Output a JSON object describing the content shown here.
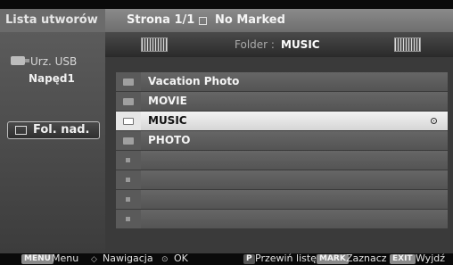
{
  "sidebar": {
    "title": "Lista utworów",
    "usb_label": "Urz. USB",
    "drive_label": "Napęd1",
    "parent_folder_label": "Fol. nad."
  },
  "header": {
    "page": "Strona 1/1",
    "marked": "No Marked"
  },
  "folder_bar": {
    "prefix": "Folder :",
    "name": "MUSIC"
  },
  "list": {
    "items": [
      {
        "label": "Vacation Photo",
        "type": "folder",
        "selected": false
      },
      {
        "label": "MOVIE",
        "type": "folder",
        "selected": false
      },
      {
        "label": "MUSIC",
        "type": "folder",
        "selected": true
      },
      {
        "label": "PHOTO",
        "type": "folder",
        "selected": false
      },
      {
        "label": "",
        "type": "empty",
        "selected": false
      },
      {
        "label": "",
        "type": "empty",
        "selected": false
      },
      {
        "label": "",
        "type": "empty",
        "selected": false
      },
      {
        "label": "",
        "type": "empty",
        "selected": false
      }
    ]
  },
  "bottom_bar": {
    "menu_key": "MENU",
    "menu_label": "Menu",
    "nav_icon": "navigation-arrows-icon",
    "nav_label": "Nawigacja",
    "ok_icon": "ok-icon",
    "ok_label": "OK",
    "scroll_key": "P",
    "scroll_label": "Przewiń listę",
    "mark_key": "MARK",
    "mark_label": "Zaznacz",
    "exit_key": "EXIT",
    "exit_label": "Wyjdź"
  }
}
